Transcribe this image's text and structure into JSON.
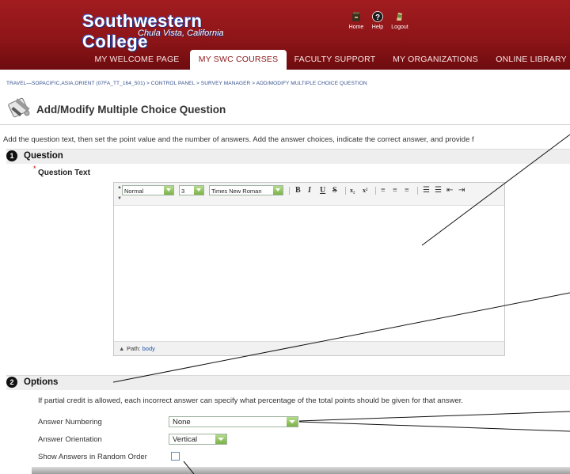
{
  "brand": {
    "name": "Southwestern College",
    "location": "Chula Vista, California",
    "primary_color": "#8e1518"
  },
  "toplinks": [
    {
      "label": "Home",
      "icon": "home-icon"
    },
    {
      "label": "Help",
      "icon": "help-icon"
    },
    {
      "label": "Logout",
      "icon": "logout-icon"
    }
  ],
  "tabs": [
    {
      "label": "MY WELCOME PAGE",
      "active": false
    },
    {
      "label": "MY SWC COURSES",
      "active": true
    },
    {
      "label": "FACULTY SUPPORT",
      "active": false
    },
    {
      "label": "MY ORGANIZATIONS",
      "active": false
    },
    {
      "label": "ONLINE LIBRARY",
      "active": false
    }
  ],
  "breadcrumb": "TRAVEL—SOPACIFIC,ASIA,ORIENT (07FA_TT_164_501) > CONTROL PANEL > SURVEY MANAGER > ADD/MODIFY MULTIPLE CHOICE QUESTION",
  "page": {
    "title": "Add/Modify Multiple Choice Question",
    "instructions": "Add the question text, then set the point value and the number of answers. Add the answer choices, indicate the correct answer, and provide f"
  },
  "question_section": {
    "number": "1",
    "title": "Question",
    "required_mark": "*",
    "field_label": "Question Text"
  },
  "editor": {
    "style_select": "Normal",
    "size_select": "3",
    "font_select": "Times New Roman",
    "buttons": [
      "B",
      "I",
      "U",
      "S",
      "x₂",
      "x²",
      "≡",
      "≡",
      "≡",
      "☰",
      "☰",
      "⇤",
      "⇥"
    ],
    "path_label": "Path:",
    "path_value": "body"
  },
  "options_section": {
    "number": "2",
    "title": "Options",
    "description": "If partial credit is allowed, each incorrect answer can specify what percentage of the total points should be given for that answer.",
    "answer_numbering_label": "Answer Numbering",
    "answer_numbering_value": "None",
    "answer_orientation_label": "Answer Orientation",
    "answer_orientation_value": "Vertical",
    "random_order_label": "Show Answers in Random Order",
    "random_order_checked": false
  }
}
